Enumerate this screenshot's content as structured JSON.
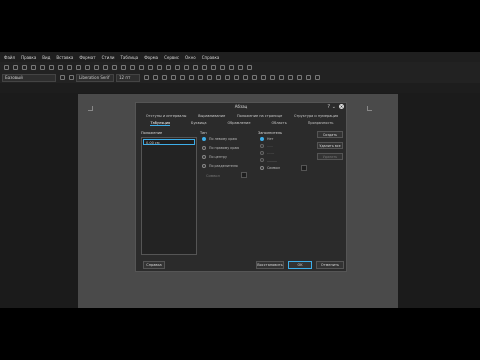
{
  "menu": [
    "Файл",
    "Правка",
    "Вид",
    "Вставка",
    "Формат",
    "Стили",
    "Таблица",
    "Форма",
    "Сервис",
    "Окно",
    "Справка"
  ],
  "toolbar": {
    "style_value": "Базовый",
    "font_value": "Liberation Serif",
    "size_value": "12 пт"
  },
  "dialog": {
    "title": "Абзац",
    "tabs_row1": [
      "Отступы и интервалы",
      "Выравнивание",
      "Положение на странице",
      "Структура и нумерация"
    ],
    "tabs_row2": [
      "Табуляция",
      "Буквица",
      "Обрамление",
      "Область",
      "Прозрачность"
    ],
    "active_tab": "Табуляция",
    "position_label": "Положение",
    "position_value": "0,00 см",
    "type_label": "Тип",
    "type_options": [
      "По левому краю",
      "По правому краю",
      "По центру",
      "По разделителю"
    ],
    "symbol_label": "Символ",
    "fill_label": "Заполнитель",
    "fill_options": [
      "Нет",
      "......",
      "------",
      "______",
      "Символ"
    ],
    "btn_new": "Создать",
    "btn_delete_all": "Удалить все",
    "btn_delete": "Удалить",
    "btn_help": "Справка",
    "btn_reset": "Восстановить",
    "btn_ok": "OK",
    "btn_cancel": "Отменить"
  }
}
